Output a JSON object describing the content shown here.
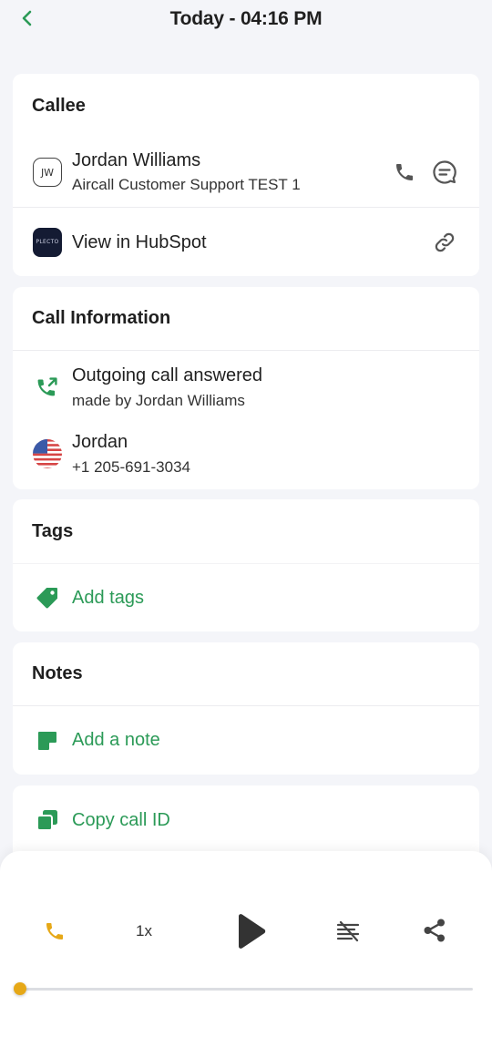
{
  "header": {
    "title": "Today - 04:16 PM"
  },
  "callee": {
    "section_title": "Callee",
    "avatar_initials": "JW",
    "name": "Jordan Williams",
    "subtitle": "Aircall Customer Support TEST 1",
    "hubspot_logo_text": "PLECTO",
    "hubspot_label": "View in HubSpot"
  },
  "call_info": {
    "section_title": "Call Information",
    "direction": "Outgoing call answered",
    "made_by": "made by Jordan Williams",
    "contact_name": "Jordan",
    "contact_number": "+1 205-691-3034"
  },
  "tags": {
    "section_title": "Tags",
    "add_label": "Add tags"
  },
  "notes": {
    "section_title": "Notes",
    "add_label": "Add a note"
  },
  "copy": {
    "label": "Copy call ID"
  },
  "player": {
    "speed": "1x",
    "progress_fraction": 0.0
  },
  "colors": {
    "accent_green": "#2b9a57",
    "player_accent": "#e6a817",
    "background": "#f4f5f9"
  }
}
